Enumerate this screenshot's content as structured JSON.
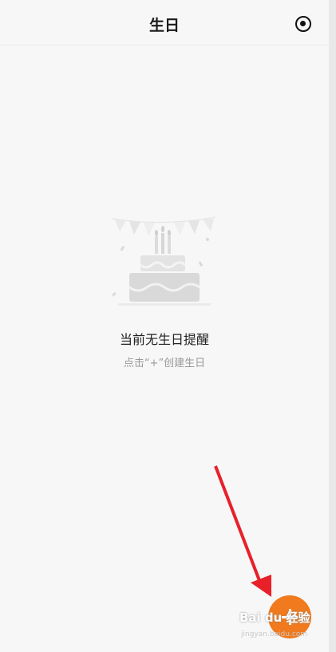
{
  "header": {
    "title": "生日",
    "settings_icon": "record-circle-icon"
  },
  "empty_state": {
    "illustration": "birthday-cake-illustration",
    "title": "当前无生日提醒",
    "hint": "点击“+”创建生日"
  },
  "fab": {
    "icon": "plus-icon",
    "color": "#f07a1d"
  },
  "watermark": {
    "text": "Bai du 经验",
    "url": "jingyan.baidu.com"
  },
  "annotation": {
    "arrow_color": "#e8202a"
  }
}
